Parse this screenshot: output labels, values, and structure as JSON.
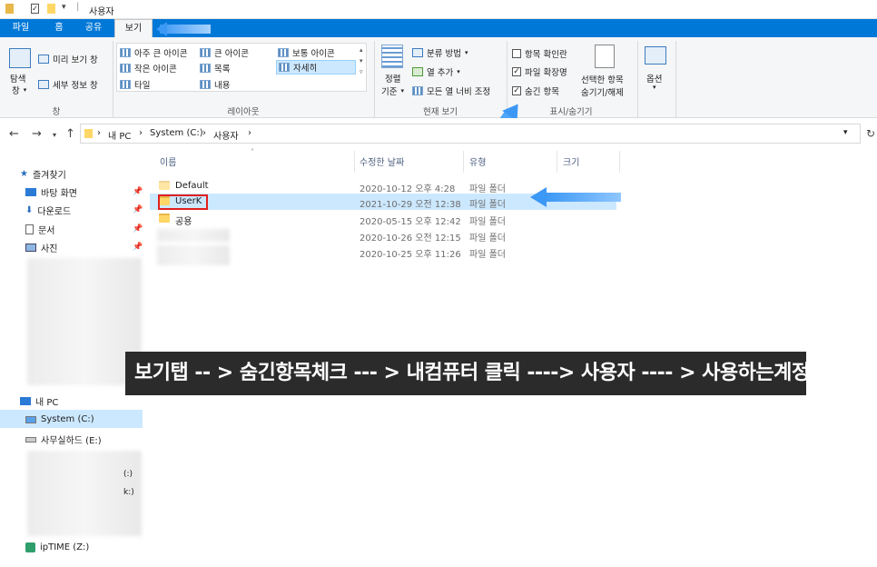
{
  "window": {
    "title": "사용자"
  },
  "tabs": [
    {
      "label": "파일"
    },
    {
      "label": "홈"
    },
    {
      "label": "공유"
    },
    {
      "label": "보기"
    }
  ],
  "ribbon": {
    "pane_group": {
      "nav_pane_line1": "탐색",
      "nav_pane_line2": "창",
      "preview": "미리 보기 창",
      "details": "세부 정보 창",
      "label": "창"
    },
    "layout_group": {
      "items": [
        "아주 큰 아이콘",
        "큰 아이콘",
        "보통 아이콘",
        "작은 아이콘",
        "목록",
        "자세히",
        "타일",
        "내용"
      ],
      "label": "레이아웃"
    },
    "current_view_group": {
      "sort_line1": "정렬",
      "sort_line2": "기준",
      "group_by": "분류 방법",
      "add_column": "열 추가",
      "fit_columns": "모든 열 너비 조정",
      "label": "현재 보기"
    },
    "show_hide_group": {
      "item_checkboxes": "항목 확인란",
      "file_extensions": "파일 확장명",
      "hidden_items": "숨긴 항목",
      "hide_selected_line1": "선택한 항목",
      "hide_selected_line2": "숨기기/해제",
      "label": "표시/숨기기"
    },
    "options": {
      "label": "옵션"
    }
  },
  "address": {
    "crumbs": [
      "내 PC",
      "System (C:)",
      "사용자"
    ]
  },
  "sidebar": {
    "quick_access": "즐겨찾기",
    "pinned": [
      "바탕 화면",
      "다운로드",
      "문서",
      "사진"
    ],
    "this_pc": "내 PC",
    "drives": [
      "System (C:)",
      "사무실하드 (E:)",
      "(:)",
      "k:)",
      "ipTIME (Z:)"
    ]
  },
  "columns": {
    "name": "이름",
    "modified": "수정한 날짜",
    "type": "유형",
    "size": "크기"
  },
  "rows": [
    {
      "name": "Default",
      "date": "2020-10-12 오후 4:28",
      "type": "파일 폴더"
    },
    {
      "name": "UserK",
      "date": "2021-10-29 오전 12:38",
      "type": "파일 폴더"
    },
    {
      "name": "공용",
      "date": "2020-05-15 오후 12:42",
      "type": "파일 폴더"
    },
    {
      "name": "",
      "date": "2020-10-26 오전 12:15",
      "type": "파일 폴더"
    },
    {
      "name": "",
      "date": "2020-10-25 오후 11:26",
      "type": "파일 폴더"
    }
  ],
  "caption": "보기탭 -- > 숨긴항목체크 --- > 내컴퓨터 클릭 ----> 사용자 ---- > 사용하는계정진입",
  "colors": {
    "accent": "#0078d7",
    "selected_row": "#cce8ff",
    "highlight_box": "#e02020",
    "arrow": "#3c98f5"
  }
}
